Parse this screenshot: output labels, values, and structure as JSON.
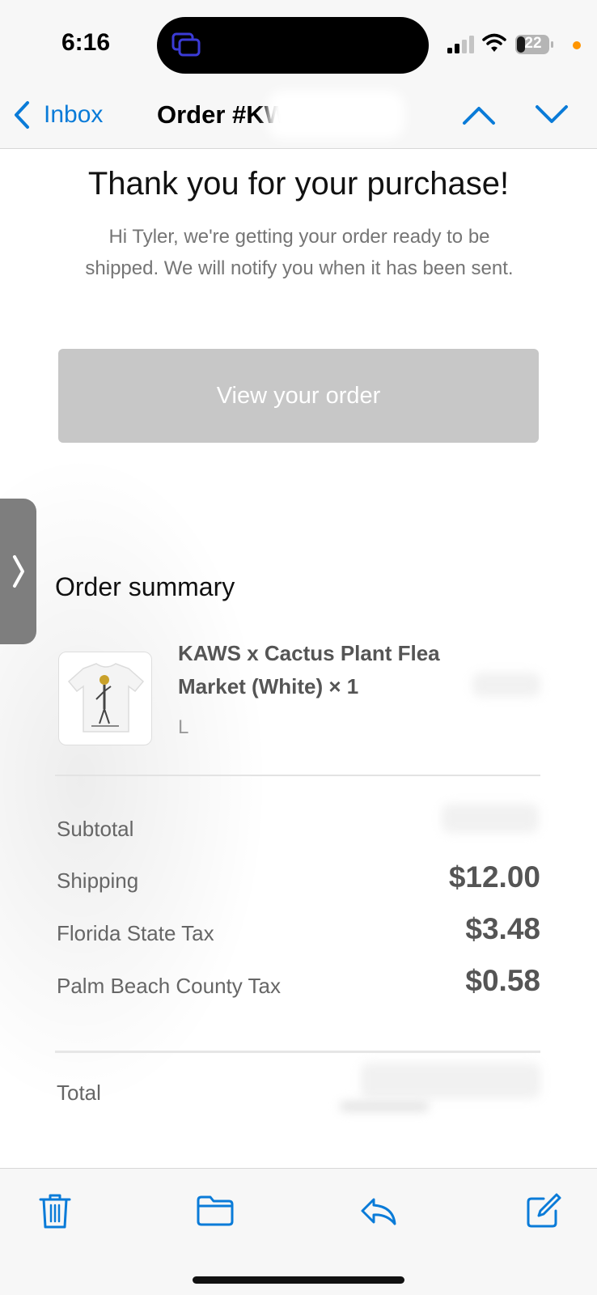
{
  "status_bar": {
    "time": "6:16",
    "battery_level": "22",
    "accent_color": "#0a7bd8"
  },
  "nav": {
    "back_label": "Inbox",
    "title": "Order #KW… c...",
    "icons": [
      "chevron-left-icon",
      "chevron-up-icon",
      "chevron-down-icon"
    ]
  },
  "email": {
    "heading": "Thank you for your purchase!",
    "intro": "Hi Tyler, we're getting your order ready to be shipped. We will notify you when it has been sent.",
    "view_order_label": "View your order",
    "order_summary_title": "Order summary",
    "item": {
      "name": "KAWS x Cactus Plant Flea Market (White) × 1",
      "size": "L"
    },
    "rows": {
      "subtotal_label": "Subtotal",
      "shipping_label": "Shipping",
      "shipping_value": "$12.00",
      "florida_tax_label": "Florida State Tax",
      "florida_tax_value": "$3.48",
      "county_tax_label": "Palm Beach County Tax",
      "county_tax_value": "$0.58",
      "total_label": "Total"
    }
  },
  "toolbar": {
    "icons": [
      "trash-icon",
      "folder-icon",
      "reply-icon",
      "compose-icon"
    ]
  }
}
